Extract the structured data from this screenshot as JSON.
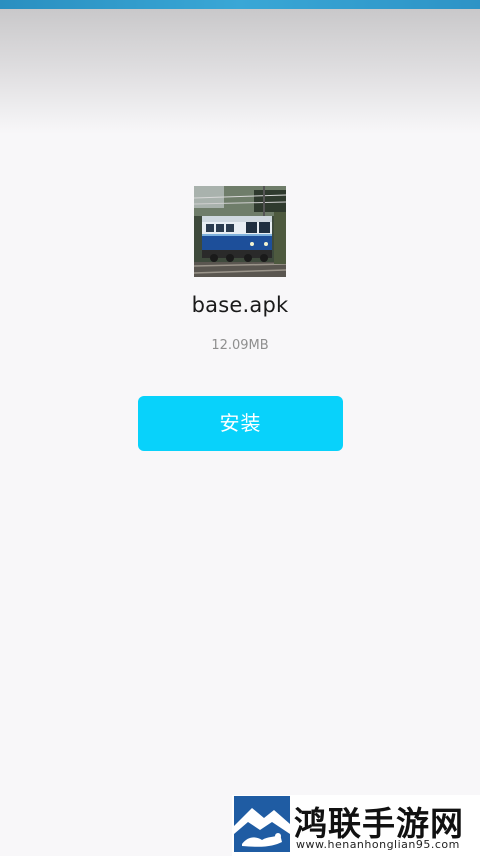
{
  "file": {
    "name": "base.apk",
    "size": "12.09MB",
    "icon": "train-locomotive-icon"
  },
  "actions": {
    "install_label": "安装"
  },
  "watermark": {
    "site_name": "鸿联手游网",
    "url": "www.henanhonglian95.com"
  },
  "colors": {
    "top_accent": "#2d93c6",
    "install_button": "#08d2fb",
    "background": "#f8f7f9"
  }
}
